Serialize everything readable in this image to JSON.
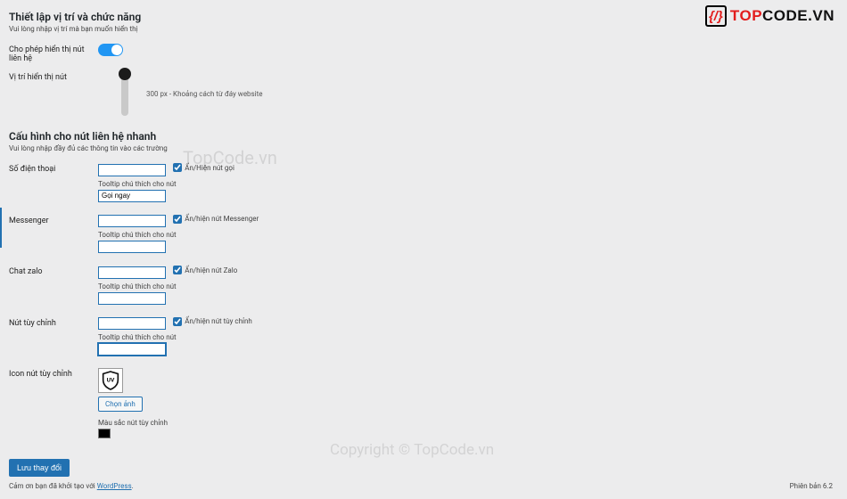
{
  "brand": {
    "name": "TOPCODE.VN"
  },
  "watermarks": {
    "top": "TopCode.vn",
    "bottom": "Copyright © TopCode.vn"
  },
  "section1": {
    "title": "Thiết lập vị trí và chức năng",
    "subtitle": "Vui lòng nhập vị trí mà bạn muốn hiển thị",
    "row_toggle_label": "Cho phép hiển thị nút liên hệ",
    "row_pos_label": "Vị trí hiển thị nút",
    "slider_text": "300 px - Khoảng cách từ đáy website"
  },
  "section2": {
    "title": "Cấu hình cho nút liên hệ nhanh",
    "subtitle": "Vui lòng nhập đầy đủ các thông tin vào các trường",
    "tooltip_label": "Tooltip chú thích cho nút",
    "tooltip_label_custom": "Tooltip chú thích cho nút",
    "fields": {
      "phone": {
        "label": "Số điện thoại",
        "cb": "Ẩn/Hiện nút gọi",
        "tooltip_value": "Gọi ngay"
      },
      "messenger": {
        "label": "Messenger",
        "cb": "Ẩn/hiện nút Messenger"
      },
      "zalo": {
        "label": "Chat zalo",
        "cb": "Ẩn/hiện nút Zalo"
      },
      "custom": {
        "label": "Nút tùy chỉnh",
        "cb": "Ẩn/hiện nút tùy chỉnh"
      }
    },
    "icon_row": {
      "label": "Icon nút tùy chỉnh",
      "button": "Chọn ảnh"
    },
    "color_row": {
      "label": "Màu sắc nút tùy chỉnh",
      "value": "#000000"
    }
  },
  "actions": {
    "save": "Lưu thay đổi"
  },
  "footer": {
    "thanks_pre": "Cảm ơn bạn đã khởi tạo với ",
    "thanks_link": "WordPress",
    "version": "Phiên bản 6.2"
  }
}
